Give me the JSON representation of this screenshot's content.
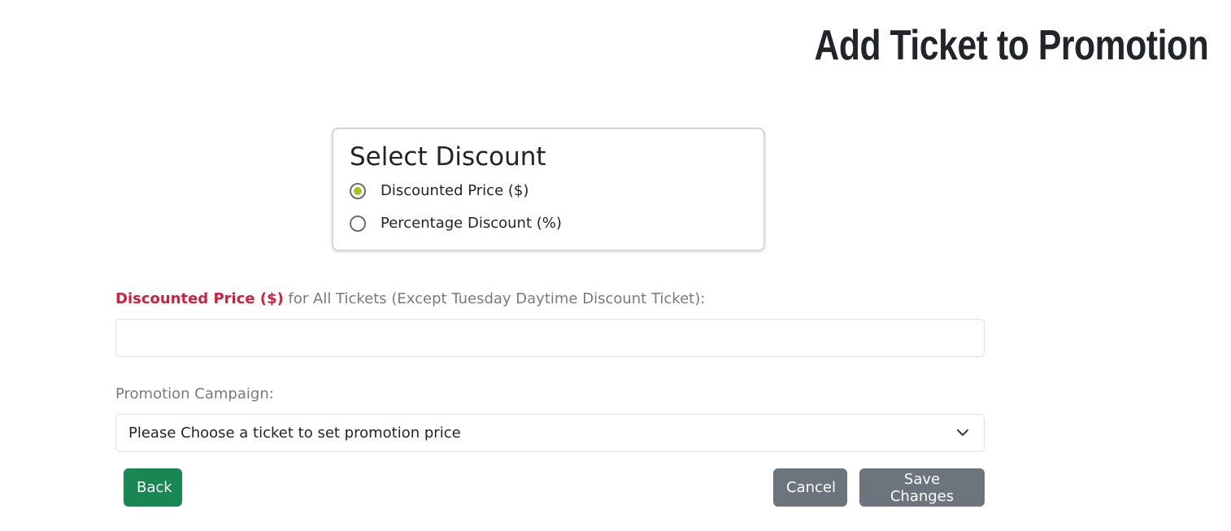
{
  "page": {
    "title": "Add Ticket to Promotion"
  },
  "discount_selector": {
    "title": "Select Discount",
    "options": [
      {
        "label": "Discounted Price ($)",
        "checked": true
      },
      {
        "label": "Percentage Discount (%)",
        "checked": false
      }
    ],
    "accent_color": "#a4c420"
  },
  "price_field": {
    "label_accent": "Discounted Price ($)",
    "label_rest": " for All Tickets (Except Tuesday Daytime Discount Ticket):",
    "value": "",
    "placeholder": ""
  },
  "campaign_field": {
    "label": "Promotion Campaign:",
    "selected": "Please Choose a ticket to set promotion price"
  },
  "buttons": {
    "back": "Back",
    "cancel": "Cancel",
    "save": "Save Changes"
  },
  "colors": {
    "label_accent": "#d21f3c",
    "back_button": "#198754",
    "secondary_button": "#6c757d"
  },
  "icons": {
    "select_chevron": "chevron-down-icon"
  }
}
